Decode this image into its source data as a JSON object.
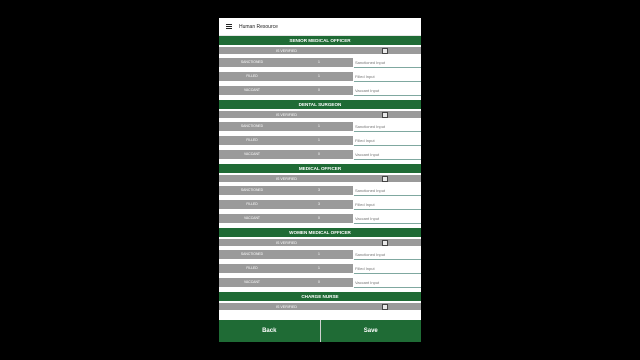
{
  "app": {
    "title": "Human Resource"
  },
  "sections": [
    {
      "title": "SENIOR MEDICAL OFFICER",
      "verified_label": "IS VERIFIED",
      "rows": [
        {
          "label": "SANCTIONED",
          "value": "1",
          "placeholder": "Sanctioned Input"
        },
        {
          "label": "FILLED",
          "value": "1",
          "placeholder": "Filled Input"
        },
        {
          "label": "VACCANT",
          "value": "0",
          "placeholder": "Vaccant Input"
        }
      ]
    },
    {
      "title": "DENTAL SURGEON",
      "verified_label": "IS VERIFIED",
      "rows": [
        {
          "label": "SANCTIONED",
          "value": "1",
          "placeholder": "Sanctioned Input"
        },
        {
          "label": "FILLED",
          "value": "1",
          "placeholder": "Filled Input"
        },
        {
          "label": "VACCANT",
          "value": "0",
          "placeholder": "Vaccant Input"
        }
      ]
    },
    {
      "title": "MEDICAL OFFICER",
      "verified_label": "IS VERIFIED",
      "rows": [
        {
          "label": "SANCTIONED",
          "value": "3",
          "placeholder": "Sanctioned Input"
        },
        {
          "label": "FILLED",
          "value": "3",
          "placeholder": "Filled Input"
        },
        {
          "label": "VACCANT",
          "value": "0",
          "placeholder": "Vaccant Input"
        }
      ]
    },
    {
      "title": "WOMEN MEDICAL OFFICER",
      "verified_label": "IS VERIFIED",
      "rows": [
        {
          "label": "SANCTIONED",
          "value": "1",
          "placeholder": "Sanctioned Input"
        },
        {
          "label": "FILLED",
          "value": "1",
          "placeholder": "Filled Input"
        },
        {
          "label": "VACCANT",
          "value": "0",
          "placeholder": "Vaccant Input"
        }
      ]
    },
    {
      "title": "CHARGE NURSE",
      "verified_label": "IS VERIFIED",
      "rows": []
    }
  ],
  "buttons": {
    "back": "Back",
    "save": "Save"
  },
  "colors": {
    "primary": "#1f6b35",
    "row_gray": "#9a9a9a",
    "background": "#000000"
  },
  "icons": {
    "menu": "hamburger-menu-icon"
  }
}
